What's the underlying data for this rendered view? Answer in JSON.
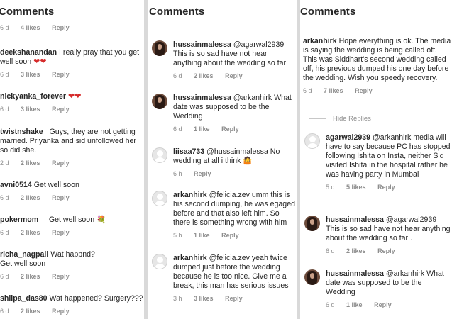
{
  "panels": [
    {
      "title": "Comments",
      "top_meta": {
        "time": "6 d",
        "likes": "4 likes",
        "reply": "Reply"
      },
      "comments": [
        {
          "user": "deekshanandan",
          "text": "I really pray that you get well soon",
          "emoji": "❤❤",
          "time": "6 d",
          "likes": "3 likes",
          "reply": "Reply"
        },
        {
          "user": "nickyanka_forever",
          "text": "",
          "emoji": "❤❤",
          "time": "6 d",
          "likes": "3 likes",
          "reply": "Reply"
        },
        {
          "user": "twistnshake_",
          "text": "Guys, they are not getting married. Priyanka and sid unfollowed her so did she.",
          "time": "2 d",
          "likes": "2 likes",
          "reply": "Reply"
        },
        {
          "user": "avni0514",
          "text": "Get well soon",
          "time": "6 d",
          "likes": "2 likes",
          "reply": "Reply"
        },
        {
          "user": "pokermom__",
          "text": "Get well soon",
          "emoji": "💐",
          "time": "6 d",
          "likes": "2 likes",
          "reply": "Reply"
        },
        {
          "user": "richa_nagpall",
          "text": "Wat happnd? Get well soon",
          "time": "6 d",
          "likes": "2 likes",
          "reply": "Reply"
        },
        {
          "user": "shilpa_das80",
          "text": "Wat happened? Surgery???",
          "time": "6 d",
          "likes": "2 likes",
          "reply": "Reply"
        }
      ]
    },
    {
      "title": "Comments",
      "comments": [
        {
          "user": "hussainmalessa",
          "avatar": "photo",
          "text": "@agarwal2939 This is so sad have not hear anything about the wedding so far",
          "time": "6 d",
          "likes": "2 likes",
          "reply": "Reply"
        },
        {
          "user": "hussainmalessa",
          "avatar": "photo",
          "text": "@arkanhirk What date was supposed to be the Wedding",
          "time": "6 d",
          "likes": "1 like",
          "reply": "Reply"
        },
        {
          "user": "liisaa733",
          "avatar": "placeholder",
          "text": "@hussainmalessa No wedding at all i think",
          "emoji": "🤷",
          "time": "6 h",
          "likes": "",
          "reply": "Reply"
        },
        {
          "user": "arkanhirk",
          "avatar": "placeholder",
          "text": "@felicia.zev umm this is his second dumping, he was egaged before and that also left him. So there is something wrong with him",
          "time": "5 h",
          "likes": "1 like",
          "reply": "Reply"
        },
        {
          "user": "arkanhirk",
          "avatar": "placeholder",
          "text": "@felicia.zev yeah twice dumped just before the wedding because he is too nice. Give me a break, this man has serious issues",
          "time": "3 h",
          "likes": "3 likes",
          "reply": "Reply"
        }
      ]
    },
    {
      "title": "Comments",
      "comments": [
        {
          "user": "arkanhirk",
          "avatar": "none",
          "text": "Hope everything is ok. The media is saying the wedding is being called off. This was Siddhart's second wedding called off, his previous dumped his one day before the wedding. Wish you speedy recovery.",
          "time": "6 d",
          "likes": "7 likes",
          "reply": "Reply"
        },
        {
          "user": "agarwal2939",
          "avatar": "placeholder",
          "text": "@arkanhirk media will have to say because PC has stopped following Ishita on Insta, neither Sid visited Ishita in the hospital rather he was having party in Mumbai",
          "time": "5 d",
          "likes": "5 likes",
          "reply": "Reply"
        },
        {
          "user": "hussainmalessa",
          "avatar": "photo",
          "text": "@agarwal2939 This is so sad have not hear anything about the wedding so far .",
          "time": "6 d",
          "likes": "2 likes",
          "reply": "Reply"
        },
        {
          "user": "hussainmalessa",
          "avatar": "photo",
          "text": "@arkanhirk What date was supposed to be the Wedding",
          "time": "6 d",
          "likes": "1 like",
          "reply": "Reply"
        }
      ],
      "hide_replies": "Hide Replies"
    }
  ]
}
